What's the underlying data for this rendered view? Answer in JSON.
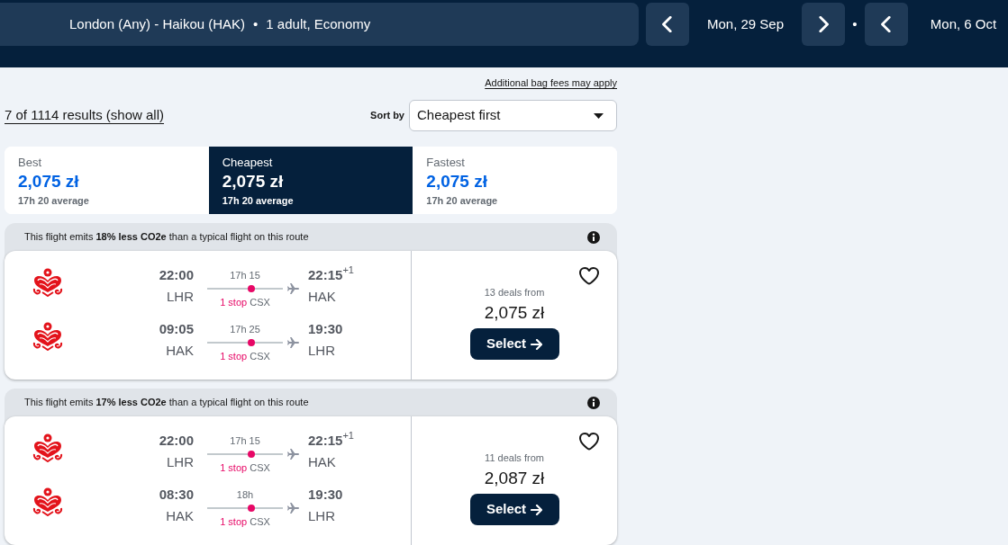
{
  "search_bar": {
    "route": "London (Any) - Haikou (HAK)",
    "separator": "•",
    "travellers": "1 adult, Economy"
  },
  "dates": {
    "outbound": "Mon, 29 Sep",
    "separator": "•",
    "return": "Mon, 6 Oct"
  },
  "bag_fees_link": "Additional bag fees may apply",
  "results_summary": "7 of 1114 results (show all)",
  "sort": {
    "label": "Sort by",
    "value": "Cheapest first"
  },
  "sort_tabs": [
    {
      "label": "Best",
      "price": "2,075 zł",
      "average": "17h 20 average",
      "selected": false
    },
    {
      "label": "Cheapest",
      "price": "2,075 zł",
      "average": "17h 20 average",
      "selected": true
    },
    {
      "label": "Fastest",
      "price": "2,075 zł",
      "average": "17h 20 average",
      "selected": false
    }
  ],
  "results": [
    {
      "emissions_note": "This flight emits **18% less CO2e** than a typical flight on this route",
      "legs": [
        {
          "depart_time": "22:00",
          "depart_airport": "LHR",
          "duration": "17h 15",
          "stops": "1 stop",
          "stop_airport": "CSX",
          "arrive_time": "22:15",
          "day_offset": "+1",
          "arrive_airport": "HAK"
        },
        {
          "depart_time": "09:05",
          "depart_airport": "HAK",
          "duration": "17h 25",
          "stops": "1 stop",
          "stop_airport": "CSX",
          "arrive_time": "19:30",
          "arrive_airport": "LHR"
        }
      ],
      "deals": "13 deals from",
      "price": "2,075 zł",
      "select_label": "Select",
      "saved": false
    },
    {
      "emissions_note": "This flight emits **17% less CO2e** than a typical flight on this route",
      "legs": [
        {
          "depart_time": "22:00",
          "depart_airport": "LHR",
          "duration": "17h 15",
          "stops": "1 stop",
          "stop_airport": "CSX",
          "arrive_time": "22:15",
          "day_offset": "+1",
          "arrive_airport": "HAK"
        },
        {
          "depart_time": "08:30",
          "depart_airport": "HAK",
          "duration": "18h",
          "stops": "1 stop",
          "stop_airport": "CSX",
          "arrive_time": "19:30",
          "arrive_airport": "LHR"
        }
      ],
      "deals": "11 deals from",
      "price": "2,087 zł",
      "select_label": "Select",
      "saved": false
    }
  ]
}
